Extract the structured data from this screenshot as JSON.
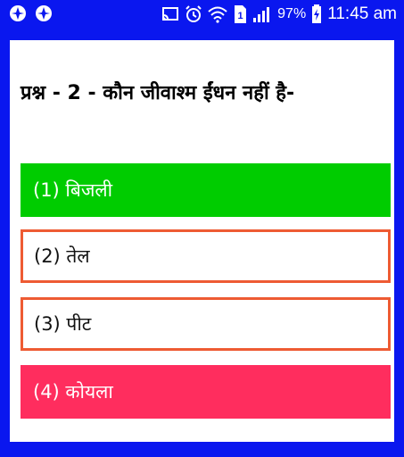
{
  "status_bar": {
    "left_icons": [
      "app-icon",
      "app-icon"
    ],
    "right_icons": [
      "cast-icon",
      "alarm-icon",
      "wifi-icon",
      "sim-icon",
      "signal-icon"
    ],
    "battery_percent": "97%",
    "time": "11:45 am"
  },
  "quiz": {
    "question": "प्रश्न - 2 - कौन जीवाश्म ईंधन नहीं है-",
    "options": [
      {
        "label": "(1) बिजली",
        "state": "correct",
        "color": "#00cc00"
      },
      {
        "label": "(2) तेल",
        "state": "neutral",
        "color": "#ee5b33"
      },
      {
        "label": "(3) पीट",
        "state": "neutral",
        "color": "#ee5b33"
      },
      {
        "label": "(4) कोयला",
        "state": "wrong",
        "color": "#ff2d5e"
      }
    ]
  },
  "colors": {
    "frame": "#0a17ef",
    "card": "#ffffff"
  }
}
